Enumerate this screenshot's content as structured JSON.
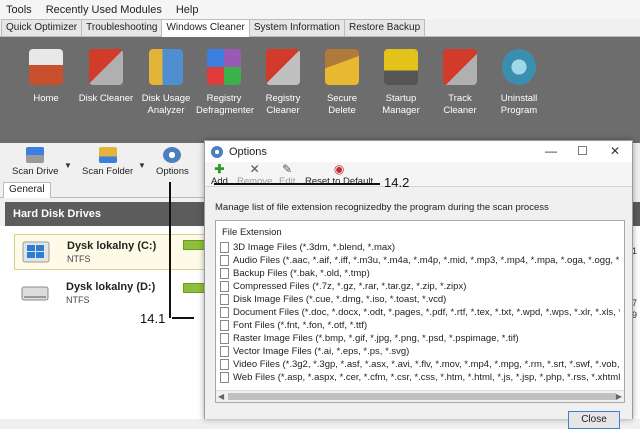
{
  "menu": [
    "Tools",
    "Recently Used Modules",
    "Help"
  ],
  "tabs": [
    {
      "label": "Quick Optimizer"
    },
    {
      "label": "Troubleshooting"
    },
    {
      "label": "Windows Cleaner"
    },
    {
      "label": "System Information"
    },
    {
      "label": "Restore Backup"
    }
  ],
  "ribbon": [
    {
      "label": "Home",
      "color": "#c8502e"
    },
    {
      "label": "Disk Cleaner",
      "color": "#d23a2a"
    },
    {
      "label": "Disk Usage Analyzer",
      "color": "#4f8fd0"
    },
    {
      "label": "Registry Defragmenter",
      "color": "#9b59b6"
    },
    {
      "label": "Registry Cleaner",
      "color": "#d23a2a"
    },
    {
      "label": "Secure Delete",
      "color": "#e8b830"
    },
    {
      "label": "Startup Manager",
      "color": "#e3c21b"
    },
    {
      "label": "Track Cleaner",
      "color": "#d23a2a"
    },
    {
      "label": "Uninstall Program",
      "color": "#3a8fb0"
    }
  ],
  "toolbar": {
    "scan_drive": "Scan Drive",
    "scan_folder": "Scan Folder",
    "options": "Options"
  },
  "subtab": "General",
  "drives_header": "Hard Disk Drives",
  "drives": [
    {
      "name": "Dysk lokalny (C:)",
      "fs": "NTFS"
    },
    {
      "name": "Dysk lokalny (D:)",
      "fs": "NTFS"
    }
  ],
  "right_edge": [
    "1",
    "7",
    "9"
  ],
  "callouts": {
    "a": "14.1",
    "b": "14.2"
  },
  "dialog": {
    "title": "Options",
    "tools": {
      "add": "Add",
      "remove": "Remove",
      "edit": "Edit",
      "reset": "Reset to Default"
    },
    "description": "Manage list of file extension recognizedby the program during the scan process",
    "list_header": "File Extension",
    "items": [
      "3D Image Files (*.3dm, *.blend, *.max)",
      "Audio Files (*.aac, *.aif, *.iff, *.m3u, *.m4a, *.m4p, *.mid, *.mp3, *.mp4, *.mpa, *.oga, *.ogg, *.ogv, ...",
      "Backup Files (*.bak, *.old, *.tmp)",
      "Compressed Files (*.7z, *.gz, *.rar, *.tar.gz, *.zip, *.zipx)",
      "Disk Image Files (*.cue, *.dmg, *.iso, *.toast, *.vcd)",
      "Document Files (*.doc, *.docx, *.odt, *.pages, *.pdf, *.rtf, *.tex, *.txt, *.wpd, *.wps, *.xlr, *.xls, *.xl...",
      "Font Files (*.fnt, *.fon, *.otf, *.ttf)",
      "Raster Image Files (*.bmp, *.gif, *.jpg, *.png, *.psd, *.pspimage, *.tif)",
      "Vector Image Files (*.ai, *.eps, *.ps, *.svg)",
      "Video Files (*.3g2, *.3gp, *.asf, *.asx, *.avi, *.flv, *.mov, *.mp4, *.mpg, *.rm, *.srt, *.swf, *.vob, *.w...",
      "Web Files (*.asp, *.aspx, *.cer, *.cfm, *.csr, *.css, *.htm, *.html, *.js, *.jsp, *.php, *.rss, *.xhtml)"
    ],
    "close": "Close"
  }
}
